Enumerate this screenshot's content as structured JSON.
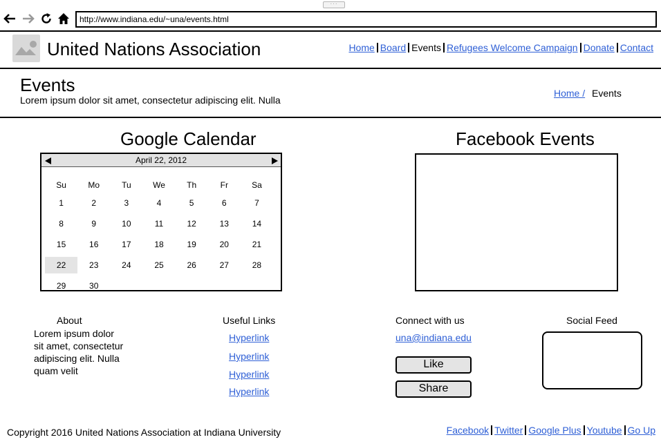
{
  "browser": {
    "url": "http://www.indiana.edu/~una/events.html",
    "icons": [
      "back-icon",
      "forward-icon",
      "refresh-icon",
      "home-icon"
    ]
  },
  "header": {
    "site_title": "United Nations Association",
    "nav": [
      {
        "label": "Home",
        "link": true
      },
      {
        "label": "Board",
        "link": true
      },
      {
        "label": "Events",
        "link": false
      },
      {
        "label": "Refugees Welcome Campaign",
        "link": true
      },
      {
        "label": "Donate",
        "link": true
      },
      {
        "label": "Contact",
        "link": true
      }
    ]
  },
  "page": {
    "title": "Events",
    "subtitle": "Lorem ipsum dolor sit amet, consectetur adipiscing elit. Nulla",
    "breadcrumb_home": "Home /",
    "breadcrumb_current": "Events"
  },
  "calendar": {
    "heading": "Google Calendar",
    "month_label": "April 22, 2012",
    "weekdays": [
      "Su",
      "Mo",
      "Tu",
      "We",
      "Th",
      "Fr",
      "Sa"
    ],
    "weeks": [
      [
        "1",
        "2",
        "3",
        "4",
        "5",
        "6",
        "7"
      ],
      [
        "8",
        "9",
        "10",
        "11",
        "12",
        "13",
        "14"
      ],
      [
        "15",
        "16",
        "17",
        "18",
        "19",
        "20",
        "21"
      ],
      [
        "22",
        "23",
        "24",
        "25",
        "26",
        "27",
        "28"
      ],
      [
        "29",
        "30",
        "",
        "",
        "",
        "",
        ""
      ]
    ],
    "selected_day": "22"
  },
  "facebook": {
    "heading": "Facebook Events"
  },
  "footer": {
    "about_heading": "About",
    "about_text": "Lorem ipsum dolor sit amet, consectetur adipiscing elit. Nulla quam velit",
    "links_heading": "Useful Links",
    "links": [
      "Hyperlink",
      "Hyperlink",
      "Hyperlink",
      "Hyperlink"
    ],
    "connect_heading": "Connect with us",
    "email": "una@indiana.edu",
    "like_label": "Like",
    "share_label": "Share",
    "social_heading": "Social Feed",
    "copyright": "Copyright 2016 United Nations Association at Indiana University",
    "nav": [
      "Facebook",
      "Twitter",
      "Google Plus",
      "Youtube",
      "Go Up"
    ]
  },
  "colors": {
    "link": "#2e5fd6",
    "calendar_header": "#e2e2e2",
    "selected_day": "#e4e4e4",
    "button_bg": "#e4e4e4"
  }
}
